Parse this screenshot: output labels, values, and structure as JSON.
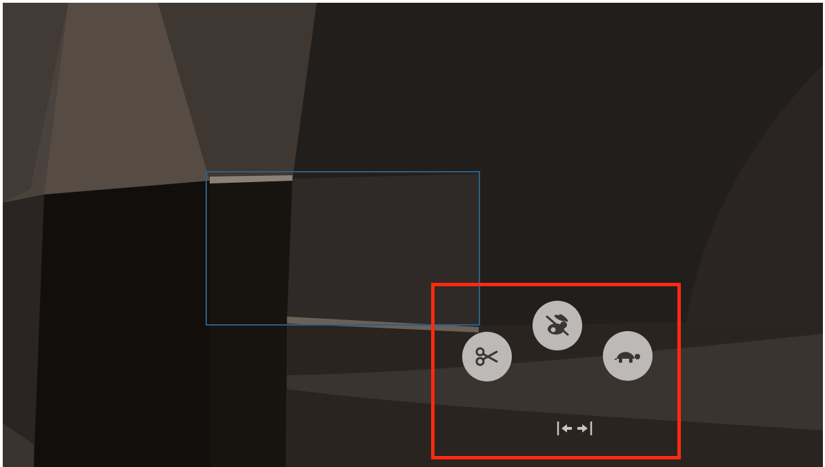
{
  "canvas": {
    "background": "#221e1b"
  },
  "selection": {
    "border_color": "#2c5f86"
  },
  "highlight": {
    "border_color": "#ff2a0f"
  },
  "controls": {
    "button_color": "#bcb9b6",
    "icon_color": "#3a3633",
    "buttons": [
      {
        "name": "cut",
        "icon": "scissors-icon"
      },
      {
        "name": "speed-up",
        "icon": "rabbit-icon"
      },
      {
        "name": "slow-down",
        "icon": "turtle-icon"
      }
    ],
    "expand_icon": "expand-horizontal-icon",
    "expand_color": "#c8c4c0"
  }
}
